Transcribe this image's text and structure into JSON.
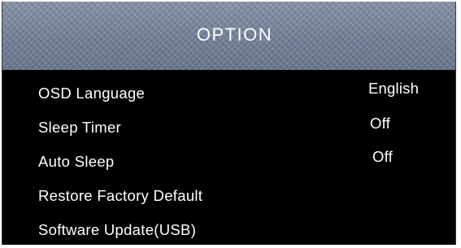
{
  "header": {
    "title": "OPTION"
  },
  "menu": {
    "items": [
      {
        "label": "OSD Language",
        "value": "English"
      },
      {
        "label": "Sleep Timer",
        "value": "Off"
      },
      {
        "label": "Auto Sleep",
        "value": "Off"
      },
      {
        "label": "Restore Factory Default"
      },
      {
        "label": "Software Update(USB)"
      }
    ]
  },
  "colors": {
    "header_background": "#7a879c",
    "menu_background": "#000000",
    "text": "#ffffff"
  }
}
